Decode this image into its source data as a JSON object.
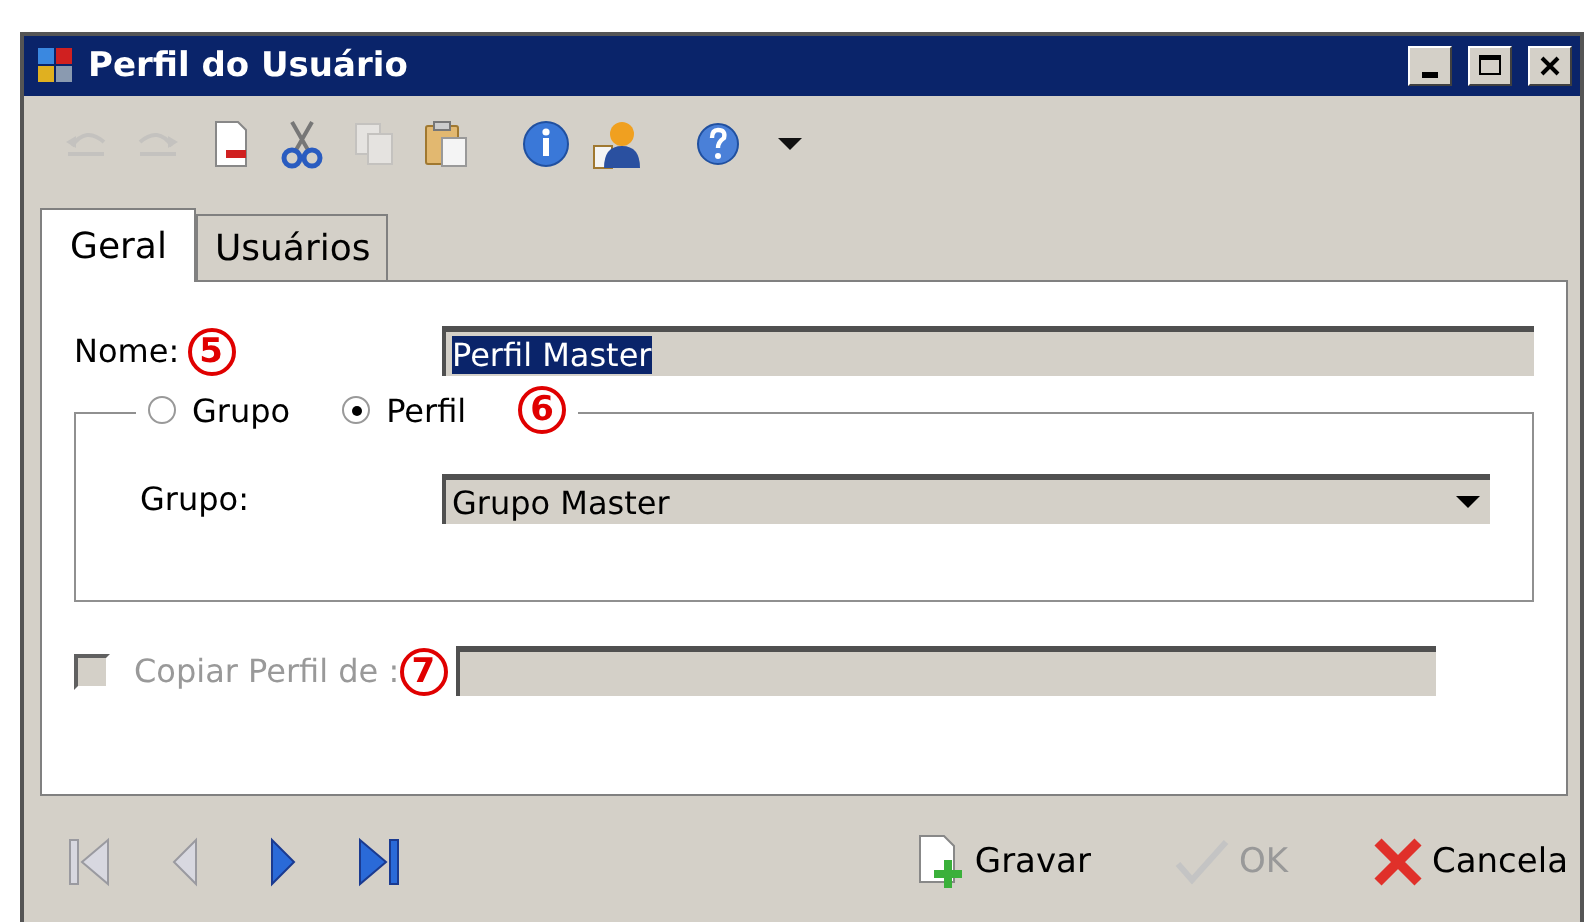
{
  "window": {
    "title": "Perfil do Usuário"
  },
  "toolbar": [
    {
      "kind": "undo",
      "disabled": true
    },
    {
      "kind": "redo",
      "disabled": true
    },
    {
      "kind": "delete",
      "disabled": false
    },
    {
      "kind": "cut",
      "disabled": false
    },
    {
      "kind": "copy",
      "disabled": true
    },
    {
      "kind": "paste",
      "disabled": false
    },
    {
      "kind": "info",
      "disabled": false
    },
    {
      "kind": "user",
      "disabled": false
    },
    {
      "kind": "help",
      "disabled": false
    },
    {
      "kind": "menu",
      "disabled": false
    }
  ],
  "tabs": [
    {
      "label": "Geral",
      "selected": true
    },
    {
      "label": "Usuários",
      "selected": false
    }
  ],
  "nome": {
    "label": "Nome:",
    "marker": "5",
    "value": "Perfil Master"
  },
  "tipo": {
    "options": [
      {
        "label": "Grupo",
        "selected": false
      },
      {
        "label": "Perfil",
        "selected": true
      }
    ],
    "marker": "6",
    "grupo_label": "Grupo:",
    "grupo_value": "Grupo Master"
  },
  "copiar": {
    "label": "Copiar Perfil de :",
    "checked": false,
    "disabled": true,
    "marker": "7"
  },
  "navigation": [
    {
      "kind": "first",
      "disabled": true
    },
    {
      "kind": "prev",
      "disabled": true
    },
    {
      "kind": "next",
      "disabled": false
    },
    {
      "kind": "last",
      "disabled": false
    }
  ],
  "actions": [
    {
      "kind": "save",
      "label": "Gravar",
      "disabled": false
    },
    {
      "kind": "ok",
      "label": "OK",
      "disabled": true
    },
    {
      "kind": "cancel",
      "label": "Cancela",
      "disabled": false
    }
  ]
}
